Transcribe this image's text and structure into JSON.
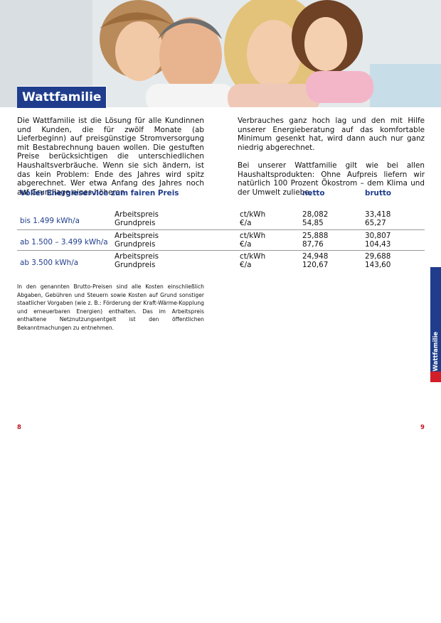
{
  "hero": {
    "image": "family-photo"
  },
  "title": "Wattfamilie",
  "intro": {
    "left": "Die Wattfamilie ist die Lösung für alle Kundinnen und Kunden, die für zwölf Monate (ab Lieferbeginn) auf preisgünstige Stromversorgung mit Bestabrechnung bauen wollen. Die gestuften Preise berücksichtigen die unterschiedlichen Haushaltsverbräuche. Wenn sie sich ändern, ist das kein Problem: Ende des Jahres wird spitz abgerechnet. Wer etwa Anfang des Jahres noch auf Grundlage eines höheren",
    "right_p1": "Verbrauches ganz hoch lag und den mit Hilfe unserer Energieberatung auf das komfortable Minimum gesenkt hat, wird dann auch nur ganz niedrig abgerechnet.",
    "right_p2": "Bei unserer Wattfamilie gilt wie bei allen Haushaltsprodukten: Ohne Aufpreis liefern wir natürlich 100 Prozent Ökostrom – dem Klima und der Umwelt zuliebe."
  },
  "table": {
    "heading": "Voller Energieservice zum fairen Preis",
    "col_netto": "netto",
    "col_brutto": "brutto",
    "rows": [
      {
        "tier": "bis 1.499 kWh/a",
        "label1": "Arbeitspreis",
        "label2": "Grundpreis",
        "unit1": "ct/kWh",
        "unit2": "€/a",
        "netto1": "28,082",
        "netto2": "54,85",
        "brutto1": "33,418",
        "brutto2": "65,27"
      },
      {
        "tier": "ab 1.500 – 3.499 kWh/a",
        "label1": "Arbeitspreis",
        "label2": "Grundpreis",
        "unit1": "ct/kWh",
        "unit2": "€/a",
        "netto1": "25,888",
        "netto2": "87,76",
        "brutto1": "30,807",
        "brutto2": "104,43"
      },
      {
        "tier": "ab 3.500 kWh/a",
        "label1": "Arbeitspreis",
        "label2": "Grundpreis",
        "unit1": "ct/kWh",
        "unit2": "€/a",
        "netto1": "24,948",
        "netto2": "120,67",
        "brutto1": "29,688",
        "brutto2": "143,60"
      }
    ]
  },
  "footnote": "In den genannten Brutto-Preisen sind alle Kosten einschließlich Abgaben, Gebühren und Steuern sowie Kosten auf Grund sonstiger staatlicher Vorgaben (wie z. B.: Förderung der Kraft-Wärme-Kopplung und erneuerbaren Energien) enthalten. Das im Arbeitspreis enthaltene Netznutzungsentgelt ist den öffentlichen Bekanntmachungen zu entnehmen.",
  "side_tab": "Wattfamilie",
  "page_left": "8",
  "page_right": "9",
  "colors": {
    "brand_blue": "#1f3d8c",
    "accent_red": "#d11e29"
  }
}
